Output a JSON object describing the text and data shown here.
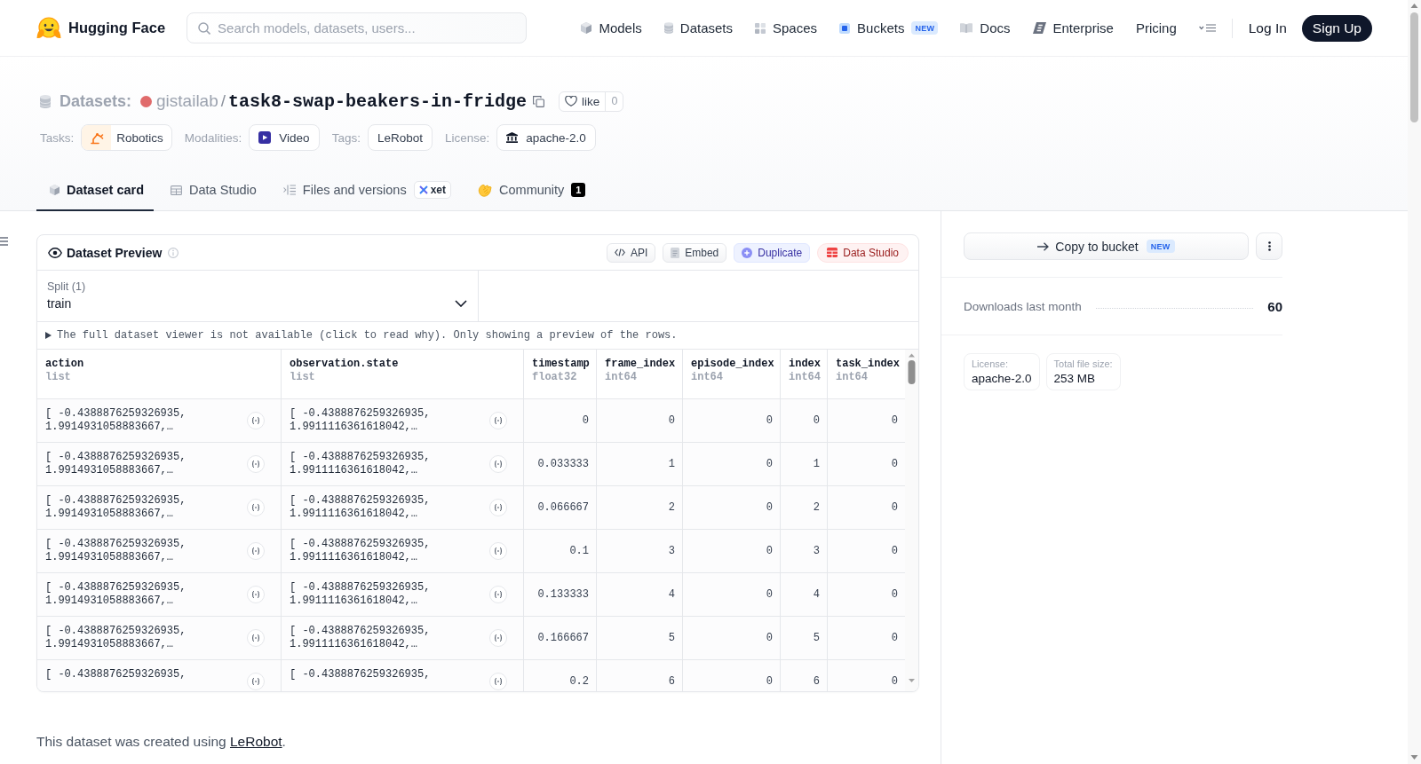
{
  "header": {
    "logo": "Hugging Face",
    "search": {
      "placeholder": "Search models, datasets, users..."
    },
    "nav": [
      {
        "label": "Models",
        "kind": "cube"
      },
      {
        "label": "Datasets",
        "kind": "database"
      },
      {
        "label": "Spaces",
        "kind": "grid"
      },
      {
        "label": "Buckets",
        "kind": "bucket",
        "badge": "NEW"
      },
      {
        "label": "Docs",
        "kind": "book"
      },
      {
        "label": "Enterprise",
        "kind": "tile"
      },
      {
        "label": "Pricing",
        "kind": "plain"
      }
    ],
    "login": "Log In",
    "signup": "Sign Up"
  },
  "repo": {
    "type": "Datasets:",
    "owner": "gistailab",
    "separator": "/",
    "name": "task8-swap-beakers-in-fridge",
    "likes": {
      "label": "like",
      "count": "0"
    }
  },
  "meta": [
    {
      "label": "Tasks:",
      "chips": [
        {
          "text": "Robotics",
          "kind": "robot"
        }
      ]
    },
    {
      "label": "Modalities:",
      "chips": [
        {
          "text": "Video",
          "kind": "video"
        }
      ]
    },
    {
      "label": "Tags:",
      "chips": [
        {
          "text": "LeRobot",
          "kind": "plain"
        }
      ]
    },
    {
      "label": "License:",
      "chips": [
        {
          "text": "apache-2.0",
          "kind": "bank"
        }
      ]
    }
  ],
  "tabs": [
    {
      "label": "Dataset card",
      "kind": "cube",
      "selected": true
    },
    {
      "label": "Data Studio",
      "kind": "table",
      "selected": false
    },
    {
      "label": "Files and versions",
      "kind": "files",
      "selected": false,
      "badge": "xet"
    },
    {
      "label": "Community",
      "kind": "hands",
      "selected": false,
      "count": "1"
    }
  ],
  "preview": {
    "title": "Dataset Preview",
    "actions": [
      {
        "label": "API",
        "kind": "api"
      },
      {
        "label": "Embed",
        "kind": "embed"
      },
      {
        "label": "Duplicate",
        "kind": "duplicate"
      },
      {
        "label": "Data Studio",
        "kind": "studio"
      }
    ],
    "split": {
      "label": "Split (1)",
      "value": "train"
    },
    "notice": {
      "text": "The full dataset viewer is not available (click to read why). Only showing a preview of the rows.",
      "expanded": false
    },
    "columns": [
      {
        "name": "action",
        "type": "list",
        "kind": "list"
      },
      {
        "name": "observation.state",
        "type": "list",
        "kind": "list"
      },
      {
        "name": "timestamp",
        "type": "float32",
        "kind": "number"
      },
      {
        "name": "frame_index",
        "type": "int64",
        "kind": "number"
      },
      {
        "name": "episode_index",
        "type": "int64",
        "kind": "number"
      },
      {
        "name": "index",
        "type": "int64",
        "kind": "number"
      },
      {
        "name": "task_index",
        "type": "int64",
        "kind": "number"
      }
    ],
    "rows": [
      [
        "[ -0.4388876259326935, 1.9914931058883667,…",
        "[ -0.4388876259326935, 1.9911116361618042,…",
        "0",
        "0",
        "0",
        "0",
        "0"
      ],
      [
        "[ -0.4388876259326935, 1.9914931058883667,…",
        "[ -0.4388876259326935, 1.9911116361618042,…",
        "0.033333",
        "1",
        "0",
        "1",
        "0"
      ],
      [
        "[ -0.4388876259326935, 1.9914931058883667,…",
        "[ -0.4388876259326935, 1.9911116361618042,…",
        "0.066667",
        "2",
        "0",
        "2",
        "0"
      ],
      [
        "[ -0.4388876259326935, 1.9914931058883667,…",
        "[ -0.4388876259326935, 1.9911116361618042,…",
        "0.1",
        "3",
        "0",
        "3",
        "0"
      ],
      [
        "[ -0.4388876259326935, 1.9914931058883667,…",
        "[ -0.4388876259326935, 1.9911116361618042,…",
        "0.133333",
        "4",
        "0",
        "4",
        "0"
      ],
      [
        "[ -0.4388876259326935, 1.9914931058883667,…",
        "[ -0.4388876259326935, 1.9911116361618042,…",
        "0.166667",
        "5",
        "0",
        "5",
        "0"
      ],
      [
        "[ -0.4388876259326935,",
        "[ -0.4388876259326935,",
        "0.2",
        "6",
        "0",
        "6",
        "0"
      ]
    ]
  },
  "footnote": {
    "before": "This dataset was created using ",
    "link": "LeRobot",
    "after": "."
  },
  "sidebar": {
    "copy": {
      "label": "Copy to bucket",
      "badge": "NEW"
    },
    "downloads": {
      "label": "Downloads last month",
      "value": "60"
    },
    "facts": [
      {
        "label": "License:",
        "value": "apache-2.0"
      },
      {
        "label": "Total file size:",
        "value": "253 MB"
      }
    ]
  }
}
